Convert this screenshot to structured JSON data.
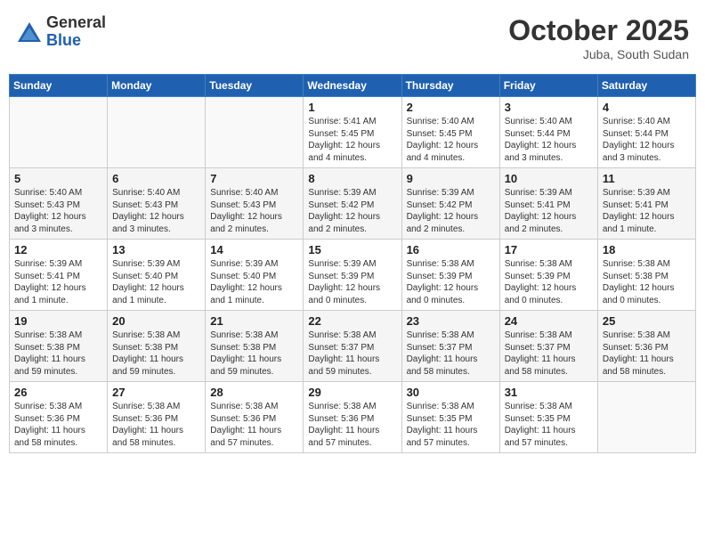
{
  "logo": {
    "general": "General",
    "blue": "Blue"
  },
  "header": {
    "month": "October 2025",
    "location": "Juba, South Sudan"
  },
  "days_of_week": [
    "Sunday",
    "Monday",
    "Tuesday",
    "Wednesday",
    "Thursday",
    "Friday",
    "Saturday"
  ],
  "weeks": [
    [
      {
        "day": "",
        "sunrise": "",
        "sunset": "",
        "daylight": ""
      },
      {
        "day": "",
        "sunrise": "",
        "sunset": "",
        "daylight": ""
      },
      {
        "day": "",
        "sunrise": "",
        "sunset": "",
        "daylight": ""
      },
      {
        "day": "1",
        "sunrise": "Sunrise: 5:41 AM",
        "sunset": "Sunset: 5:45 PM",
        "daylight": "Daylight: 12 hours and 4 minutes."
      },
      {
        "day": "2",
        "sunrise": "Sunrise: 5:40 AM",
        "sunset": "Sunset: 5:45 PM",
        "daylight": "Daylight: 12 hours and 4 minutes."
      },
      {
        "day": "3",
        "sunrise": "Sunrise: 5:40 AM",
        "sunset": "Sunset: 5:44 PM",
        "daylight": "Daylight: 12 hours and 3 minutes."
      },
      {
        "day": "4",
        "sunrise": "Sunrise: 5:40 AM",
        "sunset": "Sunset: 5:44 PM",
        "daylight": "Daylight: 12 hours and 3 minutes."
      }
    ],
    [
      {
        "day": "5",
        "sunrise": "Sunrise: 5:40 AM",
        "sunset": "Sunset: 5:43 PM",
        "daylight": "Daylight: 12 hours and 3 minutes."
      },
      {
        "day": "6",
        "sunrise": "Sunrise: 5:40 AM",
        "sunset": "Sunset: 5:43 PM",
        "daylight": "Daylight: 12 hours and 3 minutes."
      },
      {
        "day": "7",
        "sunrise": "Sunrise: 5:40 AM",
        "sunset": "Sunset: 5:43 PM",
        "daylight": "Daylight: 12 hours and 2 minutes."
      },
      {
        "day": "8",
        "sunrise": "Sunrise: 5:39 AM",
        "sunset": "Sunset: 5:42 PM",
        "daylight": "Daylight: 12 hours and 2 minutes."
      },
      {
        "day": "9",
        "sunrise": "Sunrise: 5:39 AM",
        "sunset": "Sunset: 5:42 PM",
        "daylight": "Daylight: 12 hours and 2 minutes."
      },
      {
        "day": "10",
        "sunrise": "Sunrise: 5:39 AM",
        "sunset": "Sunset: 5:41 PM",
        "daylight": "Daylight: 12 hours and 2 minutes."
      },
      {
        "day": "11",
        "sunrise": "Sunrise: 5:39 AM",
        "sunset": "Sunset: 5:41 PM",
        "daylight": "Daylight: 12 hours and 1 minute."
      }
    ],
    [
      {
        "day": "12",
        "sunrise": "Sunrise: 5:39 AM",
        "sunset": "Sunset: 5:41 PM",
        "daylight": "Daylight: 12 hours and 1 minute."
      },
      {
        "day": "13",
        "sunrise": "Sunrise: 5:39 AM",
        "sunset": "Sunset: 5:40 PM",
        "daylight": "Daylight: 12 hours and 1 minute."
      },
      {
        "day": "14",
        "sunrise": "Sunrise: 5:39 AM",
        "sunset": "Sunset: 5:40 PM",
        "daylight": "Daylight: 12 hours and 1 minute."
      },
      {
        "day": "15",
        "sunrise": "Sunrise: 5:39 AM",
        "sunset": "Sunset: 5:39 PM",
        "daylight": "Daylight: 12 hours and 0 minutes."
      },
      {
        "day": "16",
        "sunrise": "Sunrise: 5:38 AM",
        "sunset": "Sunset: 5:39 PM",
        "daylight": "Daylight: 12 hours and 0 minutes."
      },
      {
        "day": "17",
        "sunrise": "Sunrise: 5:38 AM",
        "sunset": "Sunset: 5:39 PM",
        "daylight": "Daylight: 12 hours and 0 minutes."
      },
      {
        "day": "18",
        "sunrise": "Sunrise: 5:38 AM",
        "sunset": "Sunset: 5:38 PM",
        "daylight": "Daylight: 12 hours and 0 minutes."
      }
    ],
    [
      {
        "day": "19",
        "sunrise": "Sunrise: 5:38 AM",
        "sunset": "Sunset: 5:38 PM",
        "daylight": "Daylight: 11 hours and 59 minutes."
      },
      {
        "day": "20",
        "sunrise": "Sunrise: 5:38 AM",
        "sunset": "Sunset: 5:38 PM",
        "daylight": "Daylight: 11 hours and 59 minutes."
      },
      {
        "day": "21",
        "sunrise": "Sunrise: 5:38 AM",
        "sunset": "Sunset: 5:38 PM",
        "daylight": "Daylight: 11 hours and 59 minutes."
      },
      {
        "day": "22",
        "sunrise": "Sunrise: 5:38 AM",
        "sunset": "Sunset: 5:37 PM",
        "daylight": "Daylight: 11 hours and 59 minutes."
      },
      {
        "day": "23",
        "sunrise": "Sunrise: 5:38 AM",
        "sunset": "Sunset: 5:37 PM",
        "daylight": "Daylight: 11 hours and 58 minutes."
      },
      {
        "day": "24",
        "sunrise": "Sunrise: 5:38 AM",
        "sunset": "Sunset: 5:37 PM",
        "daylight": "Daylight: 11 hours and 58 minutes."
      },
      {
        "day": "25",
        "sunrise": "Sunrise: 5:38 AM",
        "sunset": "Sunset: 5:36 PM",
        "daylight": "Daylight: 11 hours and 58 minutes."
      }
    ],
    [
      {
        "day": "26",
        "sunrise": "Sunrise: 5:38 AM",
        "sunset": "Sunset: 5:36 PM",
        "daylight": "Daylight: 11 hours and 58 minutes."
      },
      {
        "day": "27",
        "sunrise": "Sunrise: 5:38 AM",
        "sunset": "Sunset: 5:36 PM",
        "daylight": "Daylight: 11 hours and 58 minutes."
      },
      {
        "day": "28",
        "sunrise": "Sunrise: 5:38 AM",
        "sunset": "Sunset: 5:36 PM",
        "daylight": "Daylight: 11 hours and 57 minutes."
      },
      {
        "day": "29",
        "sunrise": "Sunrise: 5:38 AM",
        "sunset": "Sunset: 5:36 PM",
        "daylight": "Daylight: 11 hours and 57 minutes."
      },
      {
        "day": "30",
        "sunrise": "Sunrise: 5:38 AM",
        "sunset": "Sunset: 5:35 PM",
        "daylight": "Daylight: 11 hours and 57 minutes."
      },
      {
        "day": "31",
        "sunrise": "Sunrise: 5:38 AM",
        "sunset": "Sunset: 5:35 PM",
        "daylight": "Daylight: 11 hours and 57 minutes."
      },
      {
        "day": "",
        "sunrise": "",
        "sunset": "",
        "daylight": ""
      }
    ]
  ]
}
